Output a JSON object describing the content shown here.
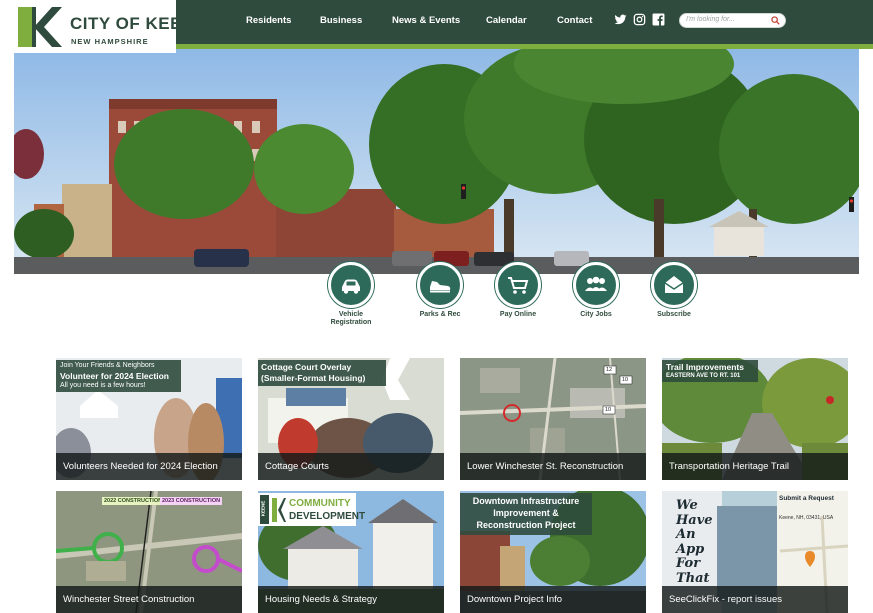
{
  "logo": {
    "title": "CITY OF KEENE",
    "subtitle": "NEW HAMPSHIRE"
  },
  "nav": {
    "items": [
      "Residents",
      "Business",
      "News & Events",
      "Calendar",
      "Contact"
    ]
  },
  "social": [
    "twitter-icon",
    "instagram-icon",
    "facebook-icon"
  ],
  "search": {
    "placeholder": "I'm looking for..."
  },
  "quick_links": [
    {
      "label_line1": "Vehicle",
      "label_line2": "Registration",
      "icon": "car-icon"
    },
    {
      "label_line1": "Parks & Rec",
      "label_line2": "",
      "icon": "shoe-icon"
    },
    {
      "label_line1": "Pay Online",
      "label_line2": "",
      "icon": "cart-icon"
    },
    {
      "label_line1": "City Jobs",
      "label_line2": "",
      "icon": "people-icon"
    },
    {
      "label_line1": "Subscribe",
      "label_line2": "",
      "icon": "envelope-icon"
    }
  ],
  "cards": [
    {
      "title": "Volunteers Needed for 2024 Election",
      "overlay": {
        "line1": "Join Your Friends & Neighbors",
        "line2": "Volunteer for 2024 Election",
        "line3": "All you need is a few hours!"
      }
    },
    {
      "title": "Cottage Courts",
      "overlay": {
        "line1": "Cottage Court Overlay",
        "line2": "(Smaller-Format Housing)"
      }
    },
    {
      "title": "Lower Winchester St. Reconstruction",
      "overlay": {
        "map_labels": [
          "12",
          "10",
          "10"
        ]
      }
    },
    {
      "title": "Transportation Heritage Trail",
      "overlay": {
        "line1": "Trail Improvements",
        "line2": "EASTERN AVE TO RT. 101"
      }
    },
    {
      "title": "Winchester Street Construction",
      "overlay": {
        "tag1": "2022 CONSTRUCTION",
        "tag2": "2023 CONSTRUCTION"
      }
    },
    {
      "title": "Housing Needs & Strategy",
      "overlay": {
        "vertical": "KEENE",
        "line1": "COMMUNITY",
        "line2": "DEVELOPMENT"
      }
    },
    {
      "title": "Downtown Project Info",
      "overlay": {
        "line1": "Downtown Infrastructure",
        "line2": "Improvement &",
        "line3": "Reconstruction Project"
      }
    },
    {
      "title": "SeeClickFix - report issues",
      "overlay": {
        "w1": "We",
        "w2": "Have",
        "w3": "An",
        "w4": "App",
        "w5": "For",
        "w6": "That",
        "submit": "Submit a Request",
        "address": "Keene, NH, 03431, USA"
      }
    }
  ],
  "colors": {
    "header_green": "#2f4b3d",
    "accent_lime": "#7fae3f",
    "circle_teal": "#2e6a5a"
  }
}
